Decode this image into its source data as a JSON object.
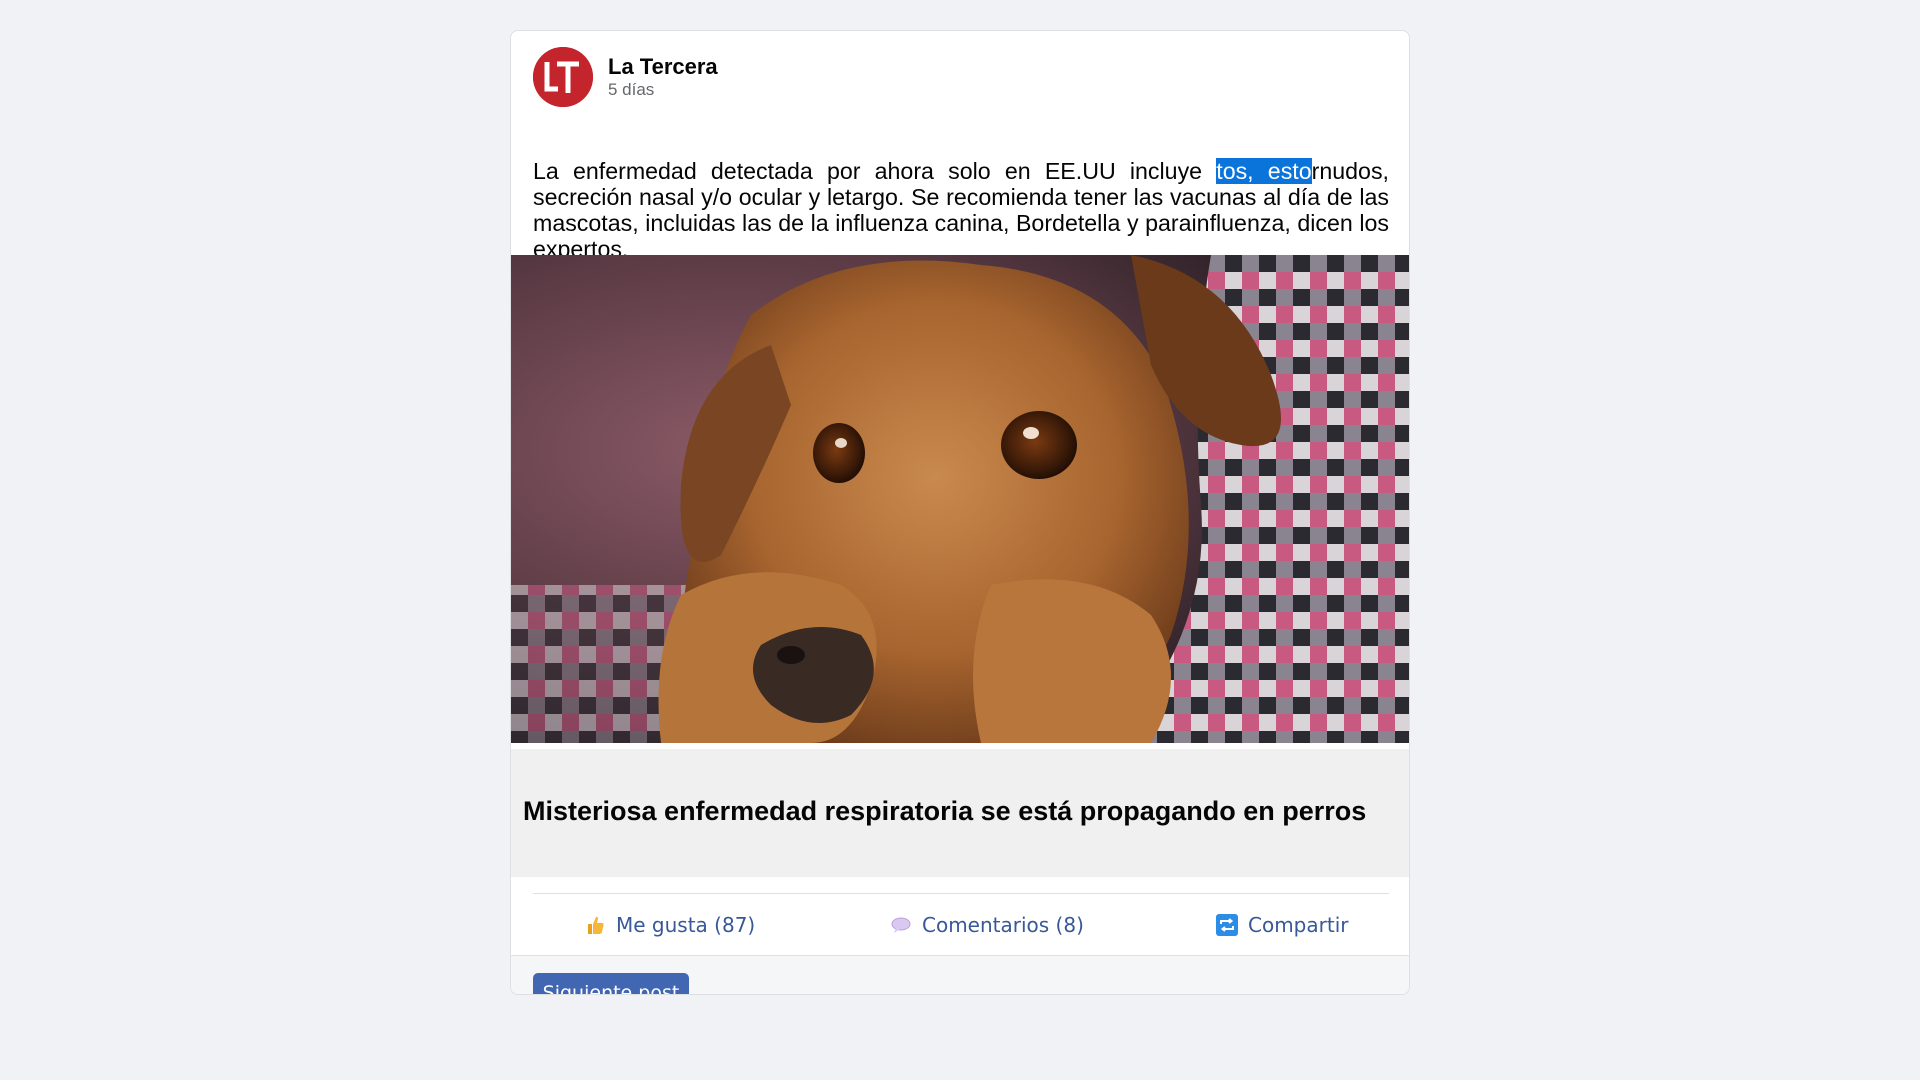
{
  "post": {
    "page_name": "La Tercera",
    "avatar_text": "LT",
    "time_ago": "5 días",
    "text_before": "La enfermedad detectada por ahora solo en EE.UU incluye ",
    "text_selected": "tos, esto",
    "text_after": "rnudos, secreción nasal y/o ocular y letargo. Se recomienda tener las vacunas al día de las mascotas, incluidas las de la influenza canina, Bordetella y parainfluenza, dicen los expertos.",
    "headline": "Misteriosa enfermedad respiratoria se está propagando en perros",
    "image_icon": "dog-photo"
  },
  "actions": {
    "like": "Me gusta (87)",
    "comment": "Comentarios (8)",
    "share": "Compartir",
    "like_icon": "thumbs-up-icon",
    "comment_icon": "speech-bubble-icon",
    "share_icon": "repeat-icon"
  },
  "footer": {
    "next_label": "Siguiente post"
  },
  "colors": {
    "brand_red": "#c4242b",
    "link_blue": "#385898",
    "button_blue": "#4267b2",
    "selection": "#0a74da"
  }
}
